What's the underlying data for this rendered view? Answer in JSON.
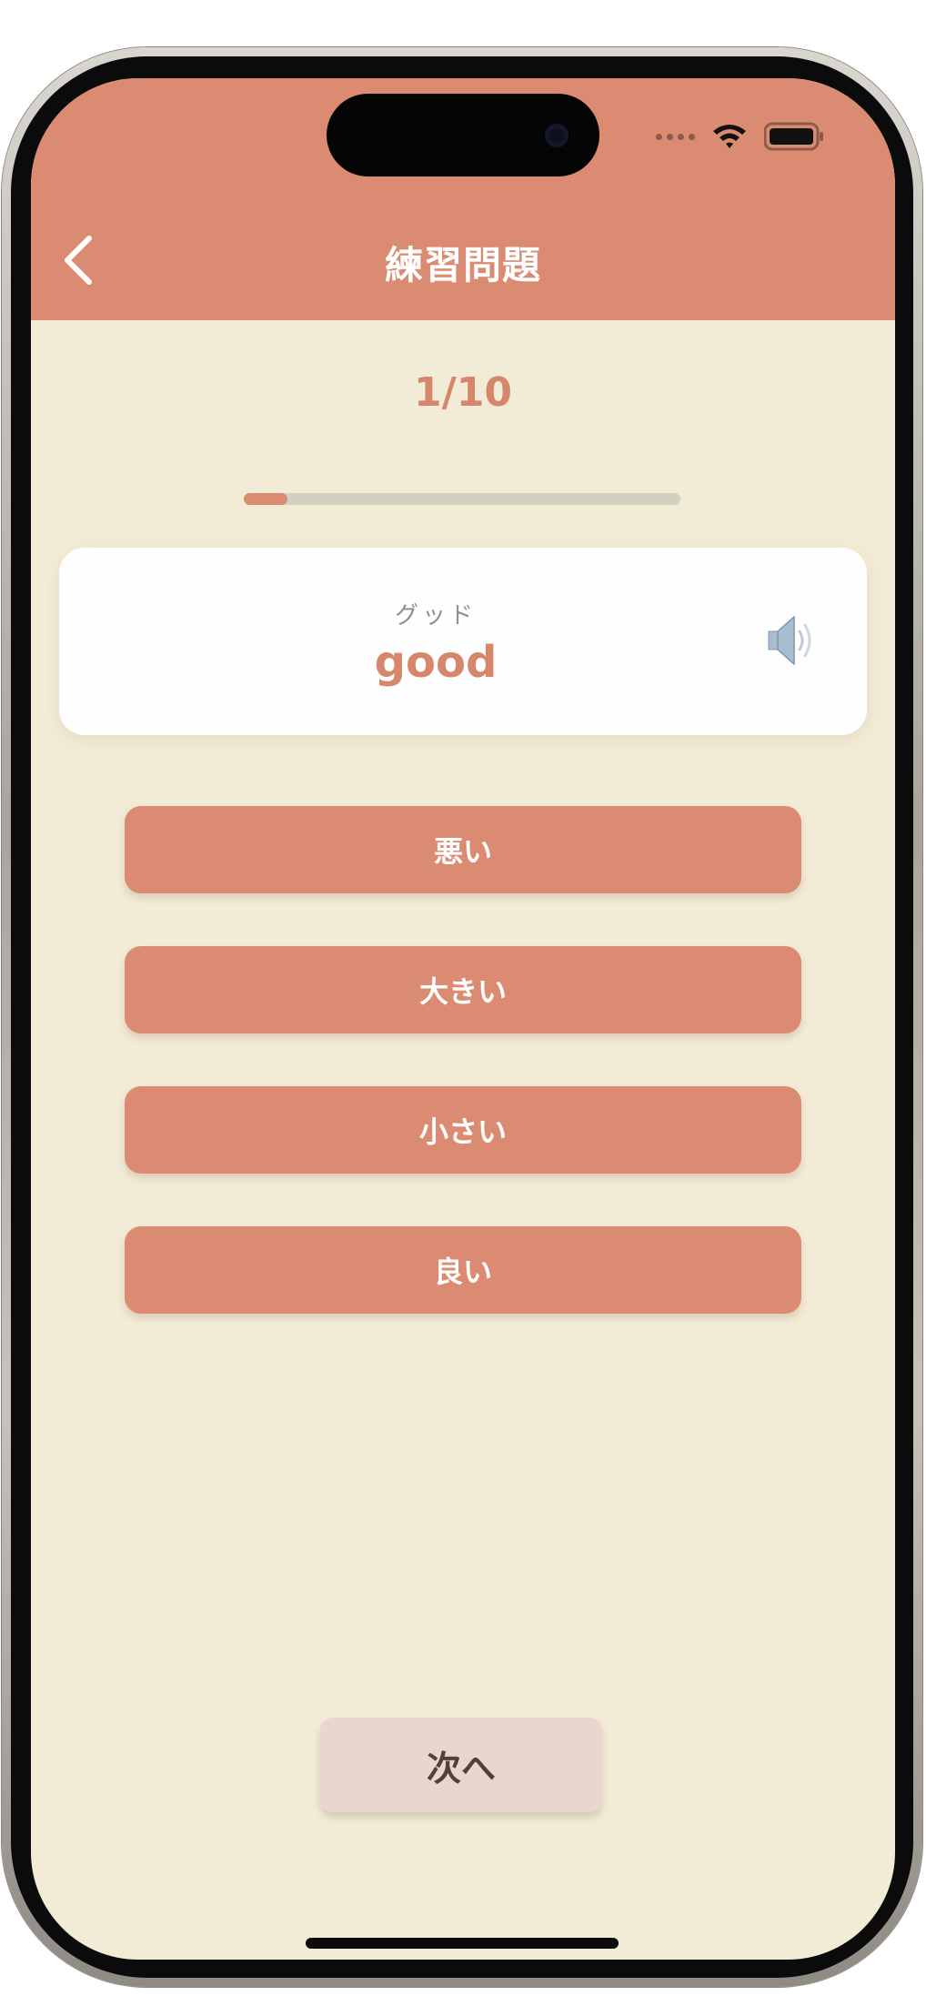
{
  "header": {
    "title": "練習問題",
    "background": "#da8b71"
  },
  "quiz": {
    "counter": "1/10",
    "progress_fraction": 0.1,
    "reading": "グッド",
    "word": "good",
    "speaker_icon": "speaker-icon"
  },
  "choices": [
    {
      "label": "悪い"
    },
    {
      "label": "大きい"
    },
    {
      "label": "小さい"
    },
    {
      "label": "良い"
    }
  ],
  "footer": {
    "next_label": "次へ"
  },
  "colors": {
    "accent": "#da8b71",
    "background": "#f2ebd5",
    "next_button": "#e9d6cd"
  }
}
